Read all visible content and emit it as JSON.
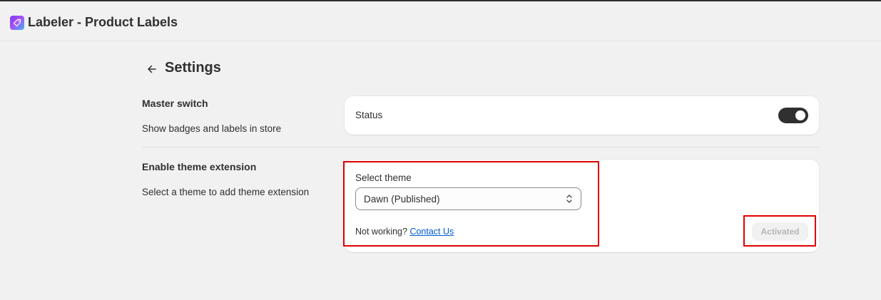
{
  "app": {
    "title": "Labeler - Product Labels",
    "icon": "tag-icon"
  },
  "page": {
    "title": "Settings",
    "back_icon": "arrow-left-icon"
  },
  "master_switch": {
    "title": "Master switch",
    "description": "Show badges and labels in store",
    "status_label": "Status",
    "enabled": true
  },
  "theme_extension": {
    "title": "Enable theme extension",
    "description": "Select a theme to add theme extension",
    "select_label": "Select theme",
    "selected_theme": "Dawn (Published)",
    "help_prefix": "Not working?",
    "help_link": "Contact Us",
    "activate_button": "Activated"
  },
  "colors": {
    "background": "#f1f1f1",
    "card": "#ffffff",
    "text": "#303030",
    "link": "#005bd3",
    "toggle_on": "#303030",
    "highlight": "#e00000"
  }
}
